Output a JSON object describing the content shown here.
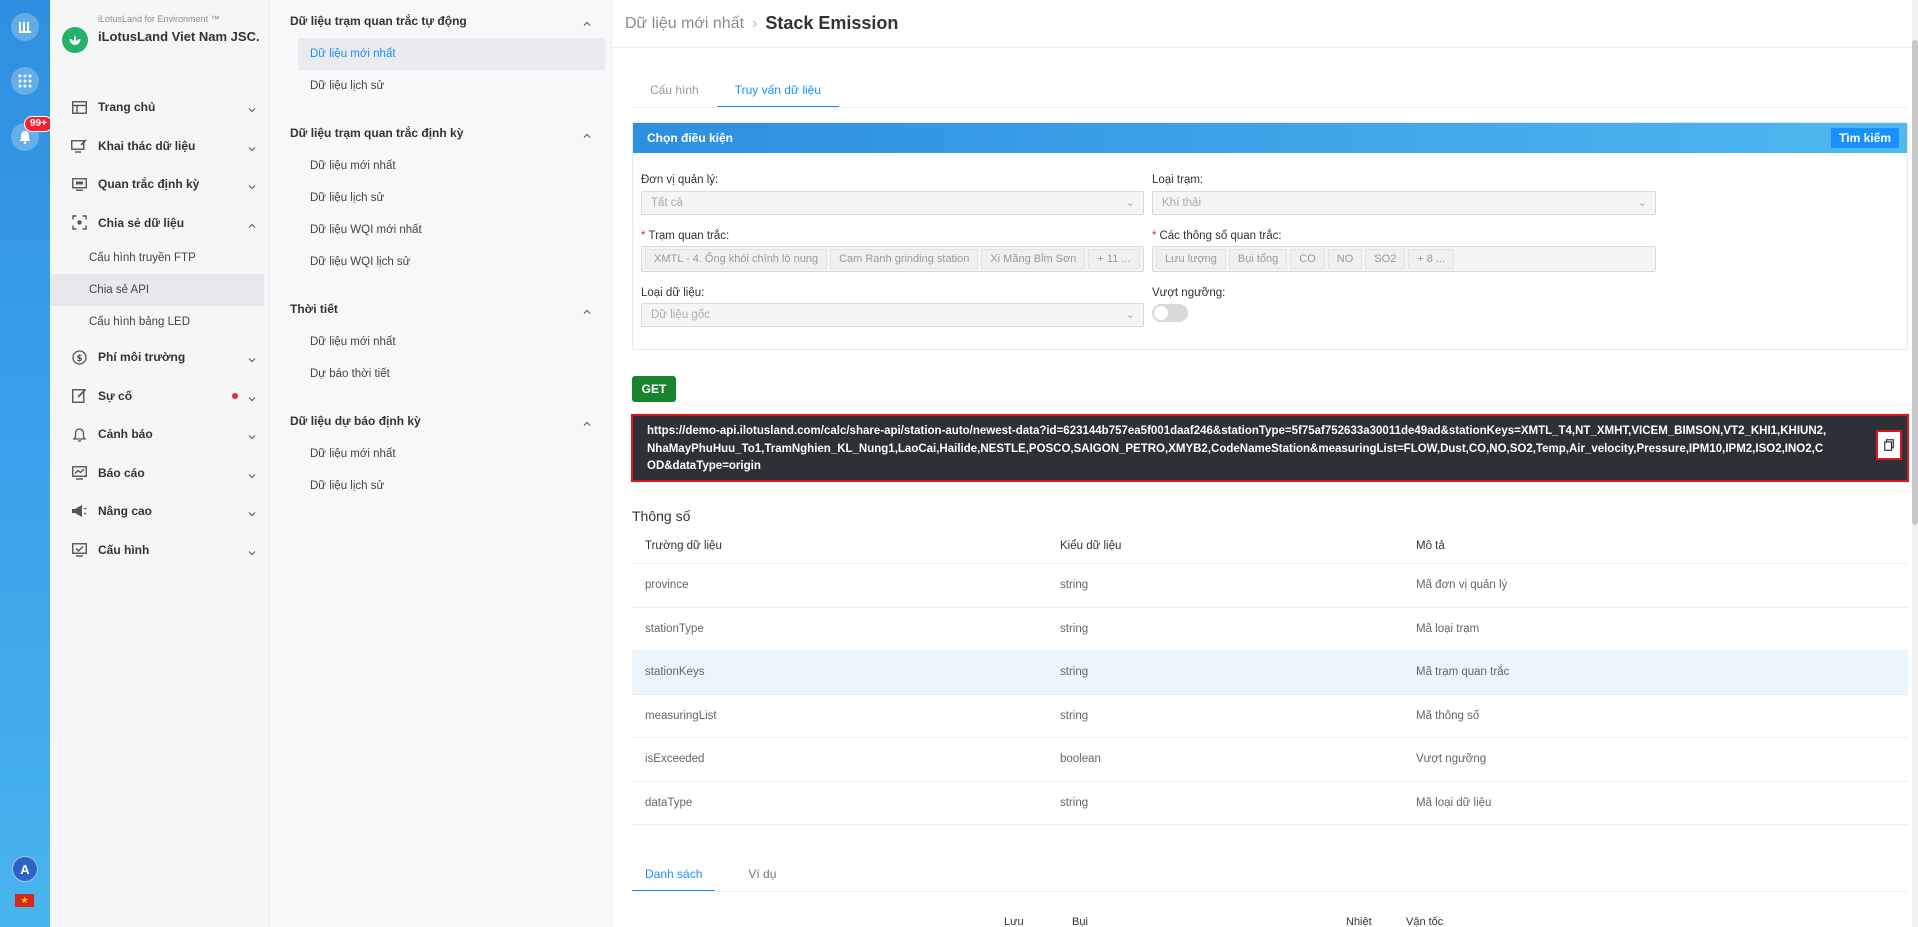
{
  "rail": {
    "notification_count": "99+",
    "avatar_letter": "A"
  },
  "brand": {
    "small": "iLotusLand for Environment ™",
    "name": "iLotusLand Viet Nam JSC."
  },
  "nav": {
    "home": "Trang chủ",
    "data_mining": "Khai thác dữ liệu",
    "periodic": "Quan trắc định kỳ",
    "share": "Chia sẻ dữ liệu",
    "share_ftp": "Cấu hình truyền FTP",
    "share_api": "Chia sẻ API",
    "share_led": "Cấu hình bảng LED",
    "fee": "Phí môi trường",
    "incident": "Sự cố",
    "warning": "Cảnh báo",
    "report": "Báo cáo",
    "advanced": "Nâng cao",
    "config": "Cấu hình"
  },
  "sidebar2": {
    "auto_title": "Dữ liệu trạm quan trắc tự động",
    "auto_latest": "Dữ liệu mới nhất",
    "auto_history": "Dữ liệu lịch sử",
    "periodic_title": "Dữ liệu trạm quan trắc định kỳ",
    "periodic_latest": "Dữ liệu mới nhất",
    "periodic_history": "Dữ liệu lịch sử",
    "periodic_wqi_latest": "Dữ liệu WQI mới nhất",
    "periodic_wqi_history": "Dữ liệu WQI lịch sử",
    "weather_title": "Thời tiết",
    "weather_latest": "Dữ liệu mới nhất",
    "weather_forecast": "Dự báo thời tiết",
    "forecast_title": "Dữ liệu dự báo định kỳ",
    "forecast_latest": "Dữ liệu mới nhất",
    "forecast_history": "Dữ liệu lịch sử"
  },
  "header": {
    "crumb_parent": "Dữ liệu mới nhất",
    "crumb_current": "Stack Emission"
  },
  "tabs": {
    "config": "Cấu hình",
    "query": "Truy vấn dữ liệu"
  },
  "filter": {
    "title": "Chọn điều kiện",
    "search_button": "Tìm kiếm",
    "unit_label": "Đơn vị quản lý:",
    "unit_value": "Tất cả",
    "station_type_label": "Loại trạm:",
    "station_type_value": "Khí thải",
    "station_label": "Trạm quan trắc:",
    "station_tags": [
      "XMTL - 4. Ống khói chính lò nung",
      "Cam Ranh grinding station",
      "Xi Măng Bỉm Sơn",
      "+ 11 ..."
    ],
    "params_label": "Các thông số quan trắc:",
    "param_tags": [
      "Lưu lượng",
      "Bụi tổng",
      "CO",
      "NO",
      "SO2",
      "+ 8 ..."
    ],
    "data_type_label": "Loại dữ liệu:",
    "data_type_value": "Dữ liệu gốc",
    "exceeded_label": "Vượt ngưỡng:"
  },
  "get_button": "GET",
  "url": "https://demo-api.ilotusland.com/calc/share-api/station-auto/newest-data?id=623144b757ea5f001daaf246&stationType=5f75af752633a30011de49ad&stationKeys=XMTL_T4,NT_XMHT,VICEM_BIMSON,VT2_KHI1,KHIUN2,NhaMayPhuHuu_To1,TramNghien_KL_Nung1,LaoCai,Hailide,NESTLE,POSCO,SAIGON_PETRO,XMYB2,CodeNameStation&measuringList=FLOW,Dust,CO,NO,SO2,Temp,Air_velocity,Pressure,IPM10,IPM2,ISO2,INO2,COD&dataType=origin",
  "params": {
    "title": "Thông số",
    "columns": [
      "Trường dữ liệu",
      "Kiểu dữ liệu",
      "Mô tả"
    ],
    "rows": [
      [
        "province",
        "string",
        "Mã đơn vị quản lý"
      ],
      [
        "stationType",
        "string",
        "Mã loại trạm"
      ],
      [
        "stationKeys",
        "string",
        "Mã trạm quan trắc"
      ],
      [
        "measuringList",
        "string",
        "Mã thông số"
      ],
      [
        "isExceeded",
        "boolean",
        "Vượt ngưỡng"
      ],
      [
        "dataType",
        "string",
        "Mã loại dữ liệu"
      ]
    ]
  },
  "bottom_tabs": {
    "list": "Danh sách",
    "example": "Ví dụ"
  },
  "list_headers": [
    "Lưu",
    "Bụi",
    "Nhiệt",
    "Vận tốc"
  ]
}
